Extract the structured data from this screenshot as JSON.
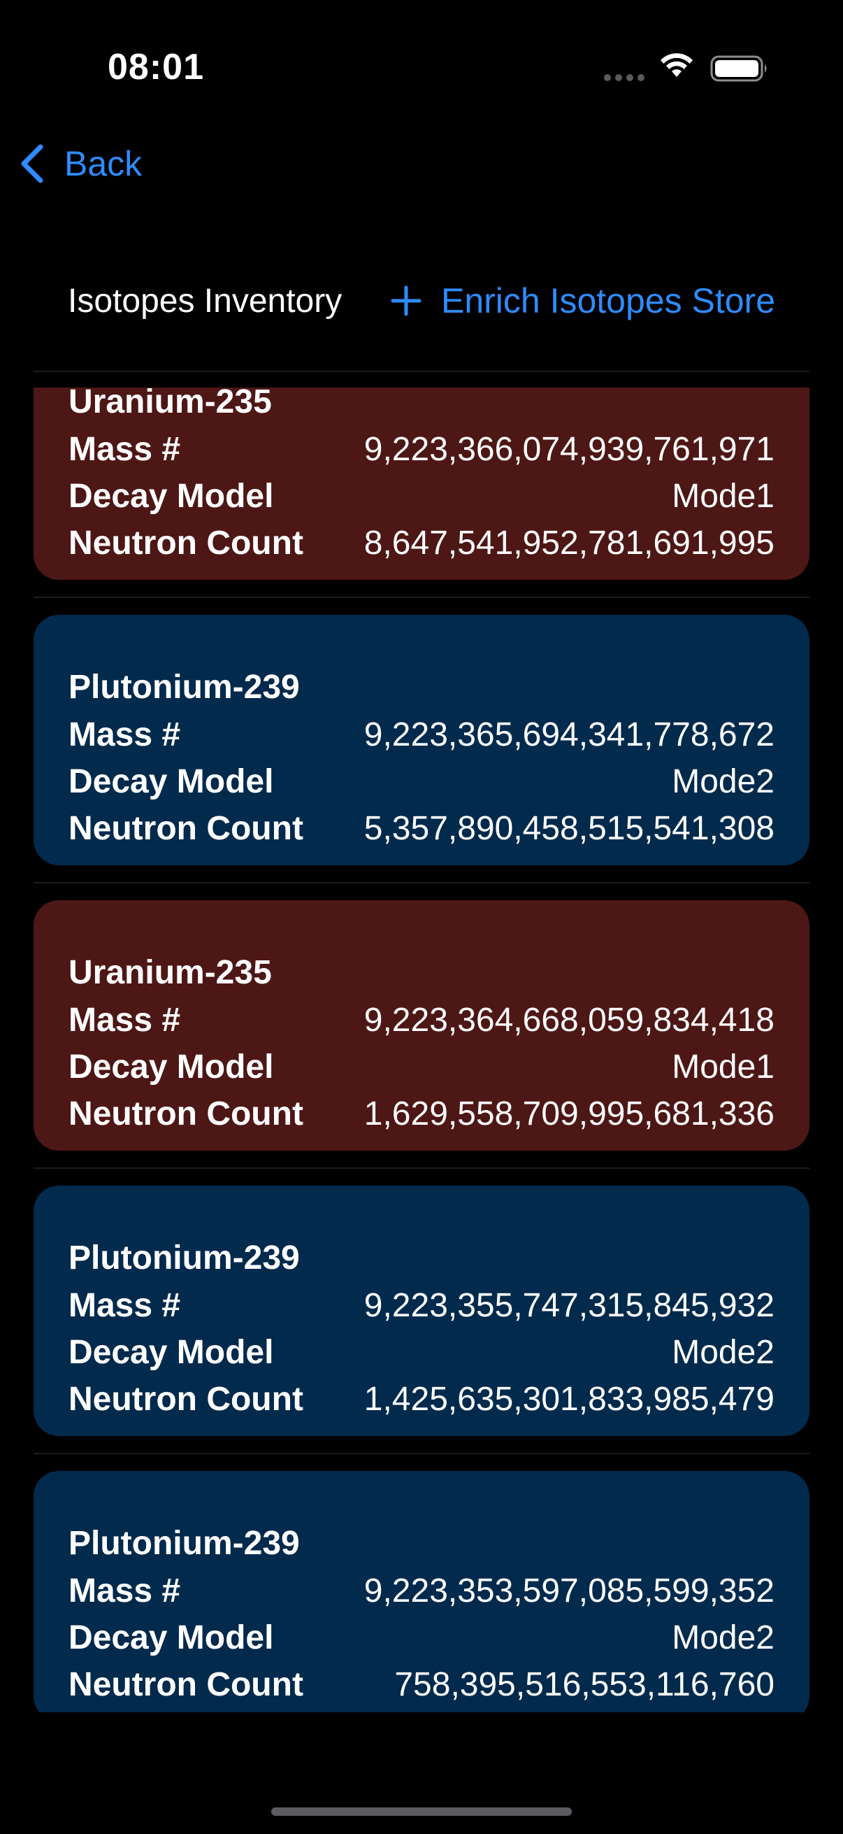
{
  "status_bar": {
    "time": "08:01"
  },
  "nav": {
    "back_label": "Back"
  },
  "header": {
    "title": "Isotopes Inventory",
    "enrich_label": "Enrich Isotopes Store"
  },
  "labels": {
    "mass": "Mass #",
    "decay": "Decay Model",
    "neutron": "Neutron Count"
  },
  "isotopes": [
    {
      "name": "Uranium-235",
      "mass": "9,223,366,074,939,761,971",
      "decay": "Mode1",
      "neutrons": "8,647,541,952,781,691,995"
    },
    {
      "name": "Plutonium-239",
      "mass": "9,223,365,694,341,778,672",
      "decay": "Mode2",
      "neutrons": "5,357,890,458,515,541,308"
    },
    {
      "name": "Uranium-235",
      "mass": "9,223,364,668,059,834,418",
      "decay": "Mode1",
      "neutrons": "1,629,558,709,995,681,336"
    },
    {
      "name": "Plutonium-239",
      "mass": "9,223,355,747,315,845,932",
      "decay": "Mode2",
      "neutrons": "1,425,635,301,833,985,479"
    },
    {
      "name": "Plutonium-239",
      "mass": "9,223,353,597,085,599,352",
      "decay": "Mode2",
      "neutrons": "758,395,516,553,116,760"
    }
  ],
  "colors": {
    "accent": "#2f8bff",
    "uranium_card": "#4d1715",
    "plutonium_card": "#022a4d",
    "background": "#000000"
  }
}
